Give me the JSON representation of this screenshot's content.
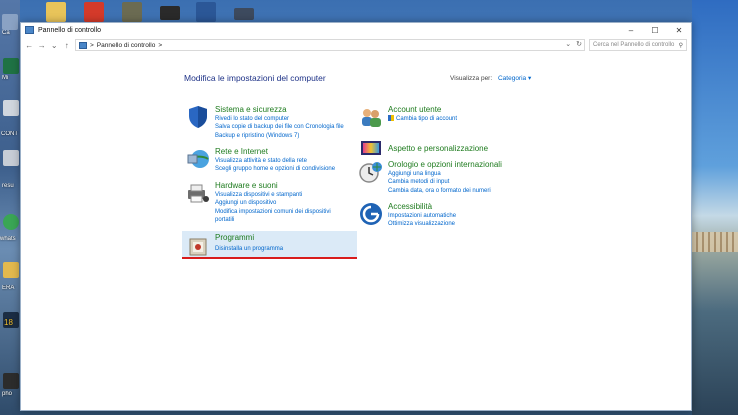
{
  "window": {
    "title": "Pannello di controllo",
    "controls": {
      "minimize": "–",
      "maximize": "☐",
      "close": "✕"
    }
  },
  "address": {
    "back": "←",
    "forward": "→",
    "recent": "⌄",
    "up": "↑",
    "breadcrumb_sep": ">",
    "breadcrumb": "Pannello di controllo",
    "breadcrumb_arrow": ">",
    "dropdown": "⌄",
    "refresh": "↻",
    "search_placeholder": "Cerca nel Pannello di controllo",
    "search_icon": "⚲"
  },
  "main": {
    "heading": "Modifica le impostazioni del computer",
    "view_by_label": "Visualizza per:",
    "view_by_value": "Categoria ▾"
  },
  "categories_left": [
    {
      "icon": "shield-icon",
      "title": "Sistema e sicurezza",
      "links": [
        "Rivedi lo stato del computer",
        "Salva copie di backup dei file con Cronologia file",
        "Backup e ripristino (Windows 7)"
      ]
    },
    {
      "icon": "network-icon",
      "title": "Rete e Internet",
      "links": [
        "Visualizza attività e stato della rete",
        "Scegli gruppo home e opzioni di condivisione"
      ]
    },
    {
      "icon": "printer-icon",
      "title": "Hardware e suoni",
      "links": [
        "Visualizza dispositivi e stampanti",
        "Aggiungi un dispositivo",
        "Modifica impostazioni comuni dei dispositivi",
        "portatili"
      ]
    },
    {
      "icon": "programs-icon",
      "title": "Programmi",
      "links": [
        "Disinstalla un programma"
      ]
    }
  ],
  "categories_right": [
    {
      "icon": "users-icon",
      "title": "Account utente",
      "links": [
        "Cambia tipo di account"
      ]
    },
    {
      "icon": "appearance-icon",
      "title": "Aspetto e personalizzazione",
      "links": []
    },
    {
      "icon": "clock-globe-icon",
      "title": "Orologio e opzioni internazionali",
      "links": [
        "Aggiungi una lingua",
        "Cambia metodi di input",
        "Cambia data, ora o formato dei numeri"
      ]
    },
    {
      "icon": "accessibility-icon",
      "title": "Accessibilità",
      "links": [
        "Impostazioni automatiche",
        "Ottimizza visualizzazione"
      ]
    }
  ],
  "desktop": {
    "labels": [
      "Ca",
      "Mi",
      "CONT",
      "resu",
      "whats",
      "ERA",
      "18",
      "pho"
    ]
  }
}
